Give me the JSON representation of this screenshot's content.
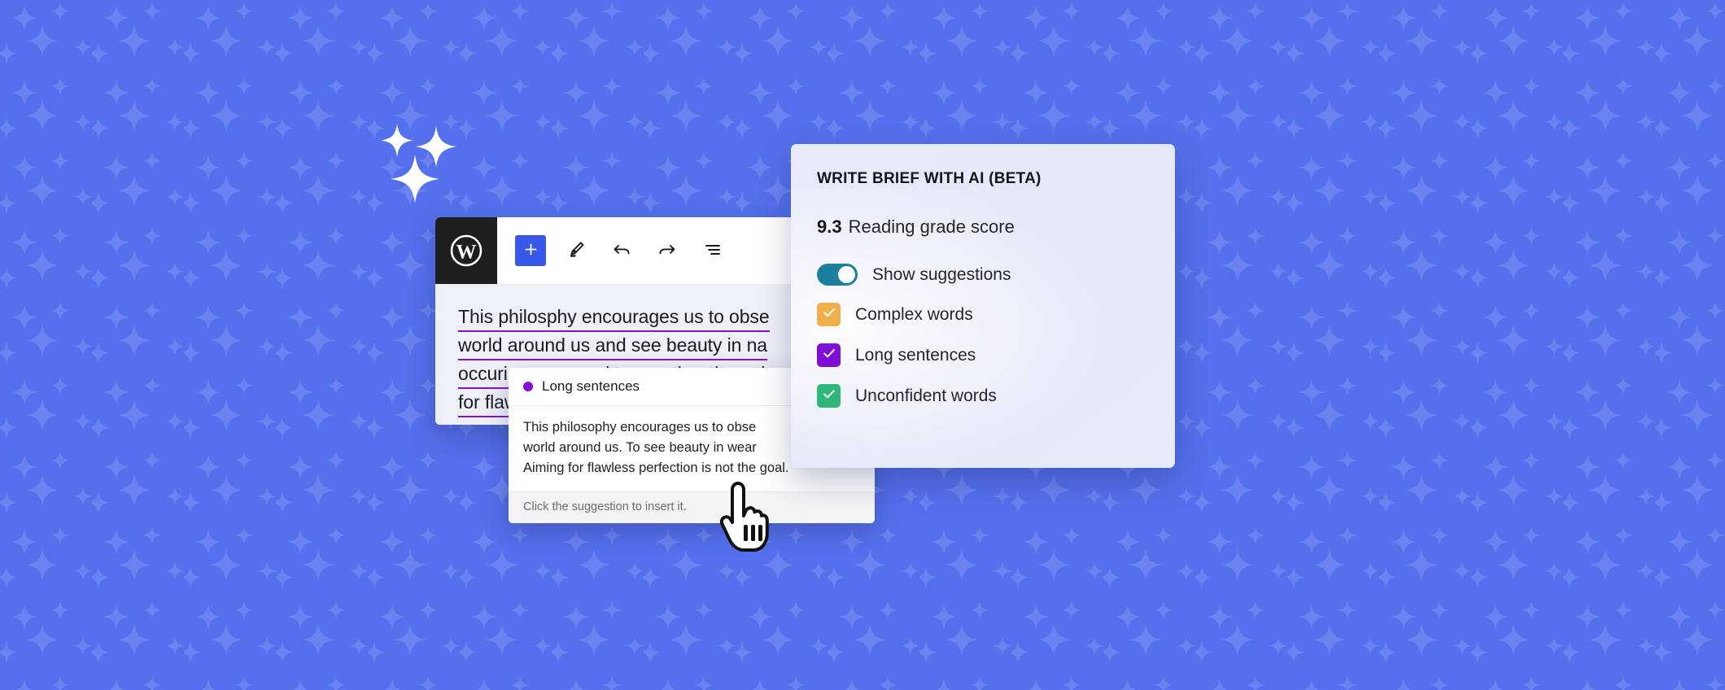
{
  "background": {
    "color": "#5470ec",
    "pattern_icon": "sparkle-pattern"
  },
  "decoration": {
    "sparkle_cluster_icon": "sparkles-icon"
  },
  "editor": {
    "logo_icon": "wordpress-logo-icon",
    "toolbar": [
      {
        "name": "add-block-button",
        "icon": "plus-icon",
        "label": "+",
        "active": true
      },
      {
        "name": "edit-tool-button",
        "icon": "pencil-icon",
        "label": ""
      },
      {
        "name": "undo-button",
        "icon": "undo-arrow-icon",
        "label": ""
      },
      {
        "name": "redo-button",
        "icon": "redo-arrow-icon",
        "label": ""
      },
      {
        "name": "document-overview-button",
        "icon": "list-view-icon",
        "label": ""
      }
    ],
    "paragraph_lines": [
      "This philosphy encourages us to obse",
      "world around us and see beauty in na",
      "occuring wear and tear, rather than ai",
      "for flawless perfection."
    ],
    "highlight_color": "#8a0fd4"
  },
  "suggestion_popup": {
    "category_label": "Long sentences",
    "category_dot_color": "#8a0fd4",
    "body_lines": [
      "This philosophy encourages us to obse",
      "world around us. To see beauty in wear",
      "Aiming for flawless perfection is not the goal."
    ],
    "footer_hint": "Click the suggestion to insert it."
  },
  "ai_panel": {
    "title": "WRITE BRIEF WITH AI (BETA)",
    "reading_score": {
      "value": "9.3",
      "label": "Reading grade score"
    },
    "options": [
      {
        "name": "show-suggestions-toggle",
        "label": "Show suggestions",
        "control": "toggle",
        "checked": true,
        "color": "#1b7f9e"
      },
      {
        "name": "complex-words-checkbox",
        "label": "Complex words",
        "control": "checkbox",
        "checked": true,
        "color": "#efb04b"
      },
      {
        "name": "long-sentences-checkbox",
        "label": "Long sentences",
        "control": "checkbox",
        "checked": true,
        "color": "#7f0fd4"
      },
      {
        "name": "unconfident-words-checkbox",
        "label": "Unconfident words",
        "control": "checkbox",
        "checked": true,
        "color": "#2db87a"
      }
    ]
  },
  "cursor": {
    "icon": "pointing-hand-cursor"
  }
}
